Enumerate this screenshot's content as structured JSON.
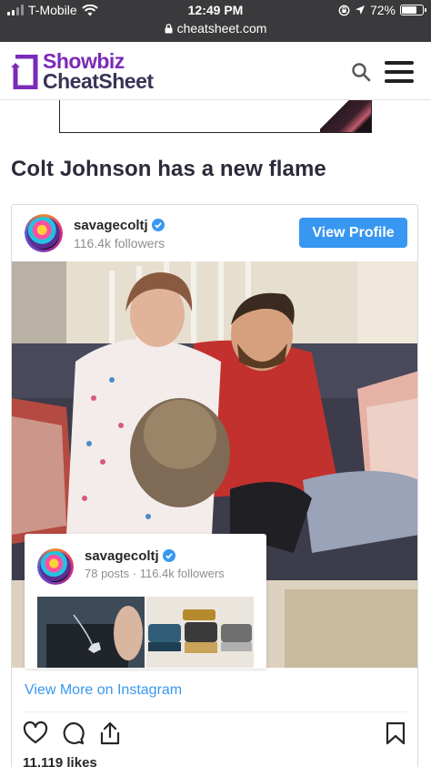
{
  "status_bar": {
    "carrier": "T-Mobile",
    "time": "12:49 PM",
    "battery": "72%",
    "battery_level": 0.72,
    "url": "cheatsheet.com"
  },
  "site": {
    "logo_line1": "Showbiz",
    "logo_line2": "CheatSheet",
    "brand_color": "#7a2ab8"
  },
  "article": {
    "headline": "Colt Johnson has a new flame"
  },
  "instagram": {
    "username": "savagecoltj",
    "followers": "116.4k followers",
    "view_profile_label": "View Profile",
    "card": {
      "username": "savagecoltj",
      "stats": "78 posts · 116.4k followers"
    },
    "view_more_label": "View More on Instagram",
    "likes": "11,119 likes",
    "accent_color": "#3897f0"
  }
}
